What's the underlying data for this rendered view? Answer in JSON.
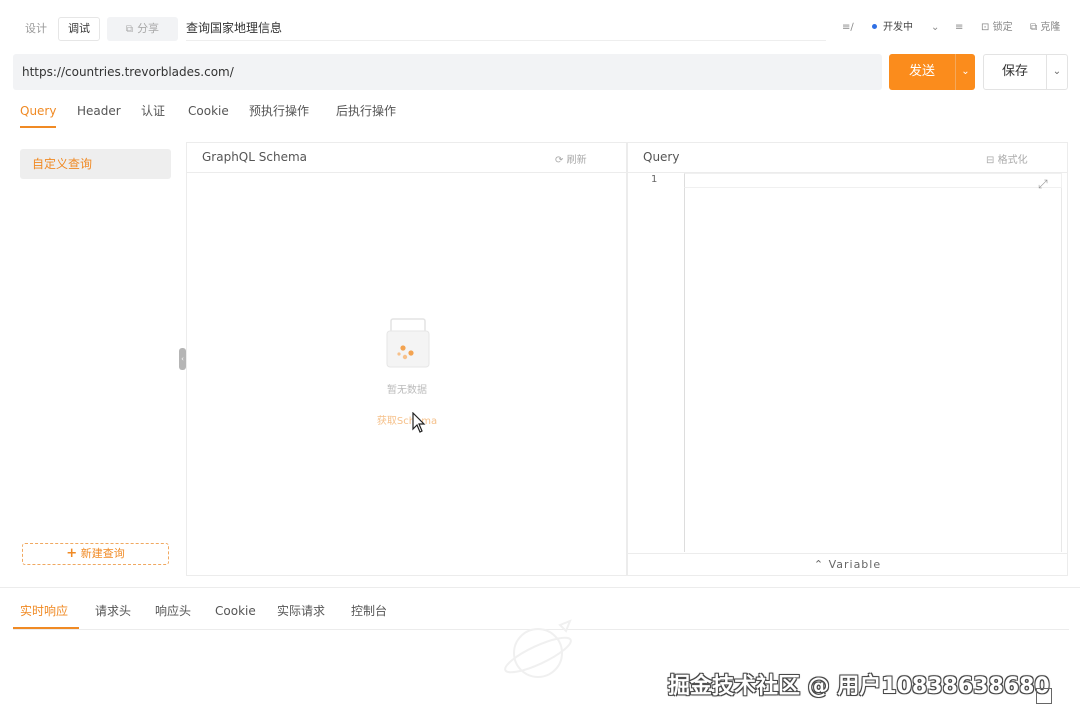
{
  "topbar": {
    "mode_design": "设计",
    "mode_debug": "调试",
    "share_label": "分享",
    "api_name": "查询国家地理信息",
    "environment": "开发中",
    "lock_label": "锁定",
    "clone_label": "克隆"
  },
  "request": {
    "url": "https://countries.trevorblades.com/",
    "send_label": "发送",
    "save_label": "保存",
    "tabs": [
      "Query",
      "Header",
      "认证",
      "Cookie",
      "预执行操作",
      "后执行操作"
    ],
    "active_tab": "Query"
  },
  "sidebar": {
    "query_item": "自定义查询",
    "new_query_label": "新建查询"
  },
  "schema_panel": {
    "title": "GraphQL Schema",
    "refresh_label": "刷新",
    "empty_text": "暂无数据",
    "fetch_label": "获取Schema"
  },
  "query_panel": {
    "title": "Query",
    "format_label": "格式化",
    "line_number": "1",
    "variable_label": "Variable"
  },
  "response": {
    "tabs": [
      "实时响应",
      "请求头",
      "响应头",
      "Cookie",
      "实际请求",
      "控制台"
    ],
    "active_tab": "实时响应"
  },
  "watermark": "掘金技术社区 @ 用户10838638680",
  "colors": {
    "accent": "#fb8c1c",
    "accent_text": "#f08a24",
    "panel_border": "#ececec",
    "input_bg": "#f2f3f5"
  }
}
